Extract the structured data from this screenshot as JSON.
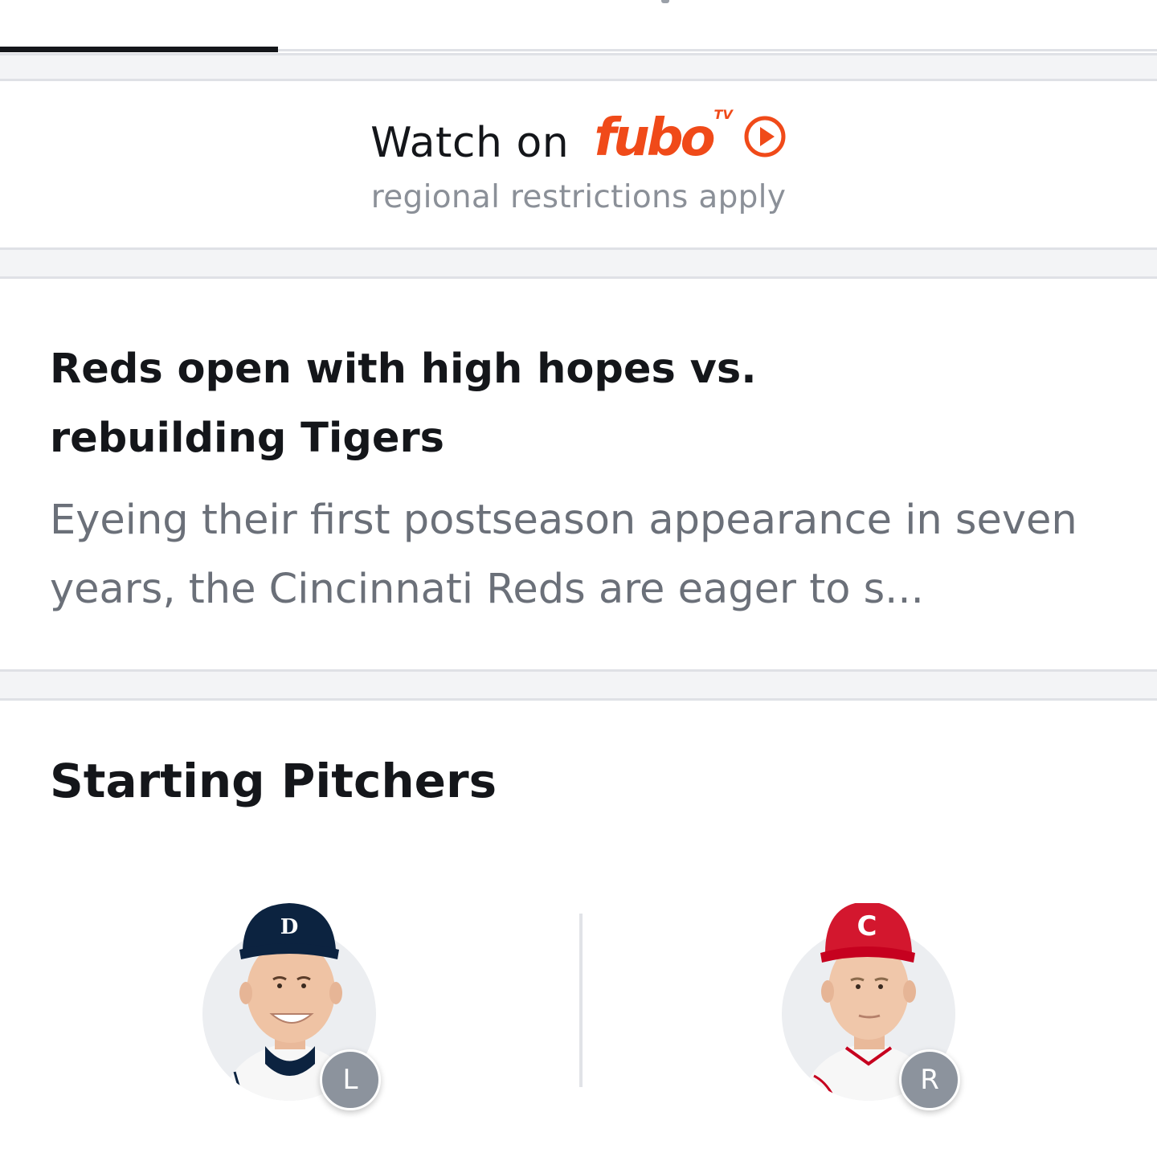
{
  "fubo_banner": {
    "watch_label": "Watch on",
    "brand": "fubo",
    "brand_superscript": "TV",
    "restriction_note": "regional restrictions apply",
    "brand_color": "#f04a19"
  },
  "article": {
    "headline": "Reds open with high hopes vs. rebuilding Tigers",
    "summary": "Eyeing their first postseason appearance in seven years, the Cincinnati Reds are eager to s..."
  },
  "starting_pitchers": {
    "title": "Starting Pitchers",
    "away": {
      "team": "Tigers",
      "throws": "L",
      "cap_color": "#0c2340",
      "icon": "tigers-player-headshot"
    },
    "home": {
      "team": "Reds",
      "throws": "R",
      "cap_color": "#c6011f",
      "icon": "reds-player-headshot"
    }
  },
  "colors": {
    "text_primary": "#14161a",
    "text_secondary": "#6b7079",
    "divider": "#dfe1e6",
    "badge": "#8c939d"
  }
}
